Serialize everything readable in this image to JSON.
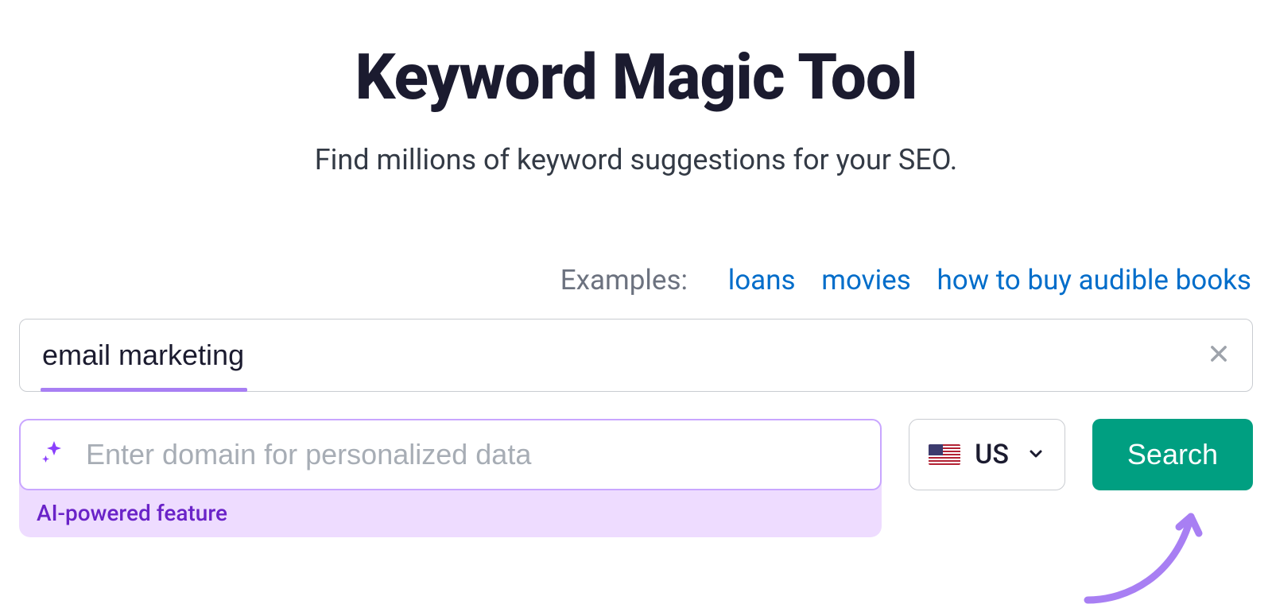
{
  "header": {
    "title": "Keyword Magic Tool",
    "subtitle": "Find millions of keyword suggestions for your SEO."
  },
  "examples": {
    "label": "Examples:",
    "items": [
      "loans",
      "movies",
      "how to buy audible books"
    ]
  },
  "search": {
    "keyword_value": "email marketing",
    "domain_placeholder": "Enter domain for personalized data",
    "ai_feature_label": "AI-powered feature",
    "country_code": "US",
    "search_button_label": "Search"
  },
  "colors": {
    "accent_purple": "#a87ff3",
    "link_blue": "#006dca",
    "search_green": "#009f81"
  }
}
